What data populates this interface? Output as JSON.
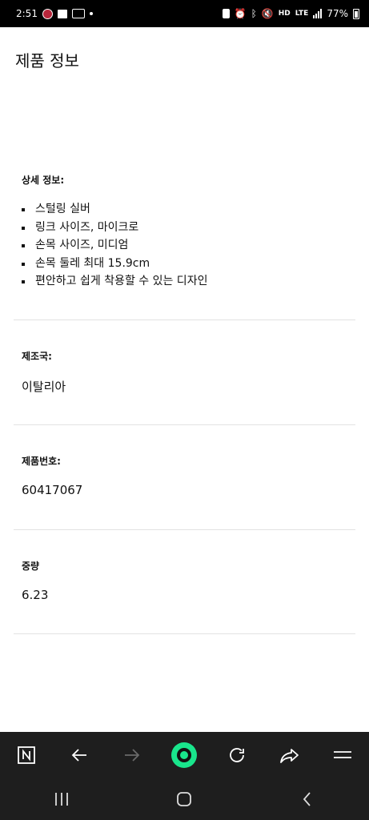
{
  "status_bar": {
    "time": "2:51",
    "battery": "77%",
    "network": "LTE"
  },
  "page": {
    "title": "제품 정보"
  },
  "details": {
    "label": "상세 정보:",
    "items": [
      "스털링 실버",
      "링크 사이즈, 마이크로",
      "손목 사이즈, 미디엄",
      "손목 둘레 최대 15.9cm",
      "편안하고 쉽게 착용할 수 있는 디자인"
    ]
  },
  "origin": {
    "label": "제조국:",
    "value": "이탈리아"
  },
  "product_number": {
    "label": "제품번호:",
    "value": "60417067"
  },
  "weight": {
    "label": "중량",
    "value": "6.23"
  },
  "colors": {
    "toolbar_bg": "#1e1e1e",
    "accent": "#19e58c"
  },
  "icons": {
    "toolbar": [
      "naver-n-icon",
      "back-arrow-icon",
      "forward-arrow-icon",
      "green-dot-home-icon",
      "reload-icon",
      "share-icon",
      "menu-icon"
    ],
    "navbar": [
      "recent-apps-icon",
      "home-icon",
      "back-icon"
    ]
  }
}
